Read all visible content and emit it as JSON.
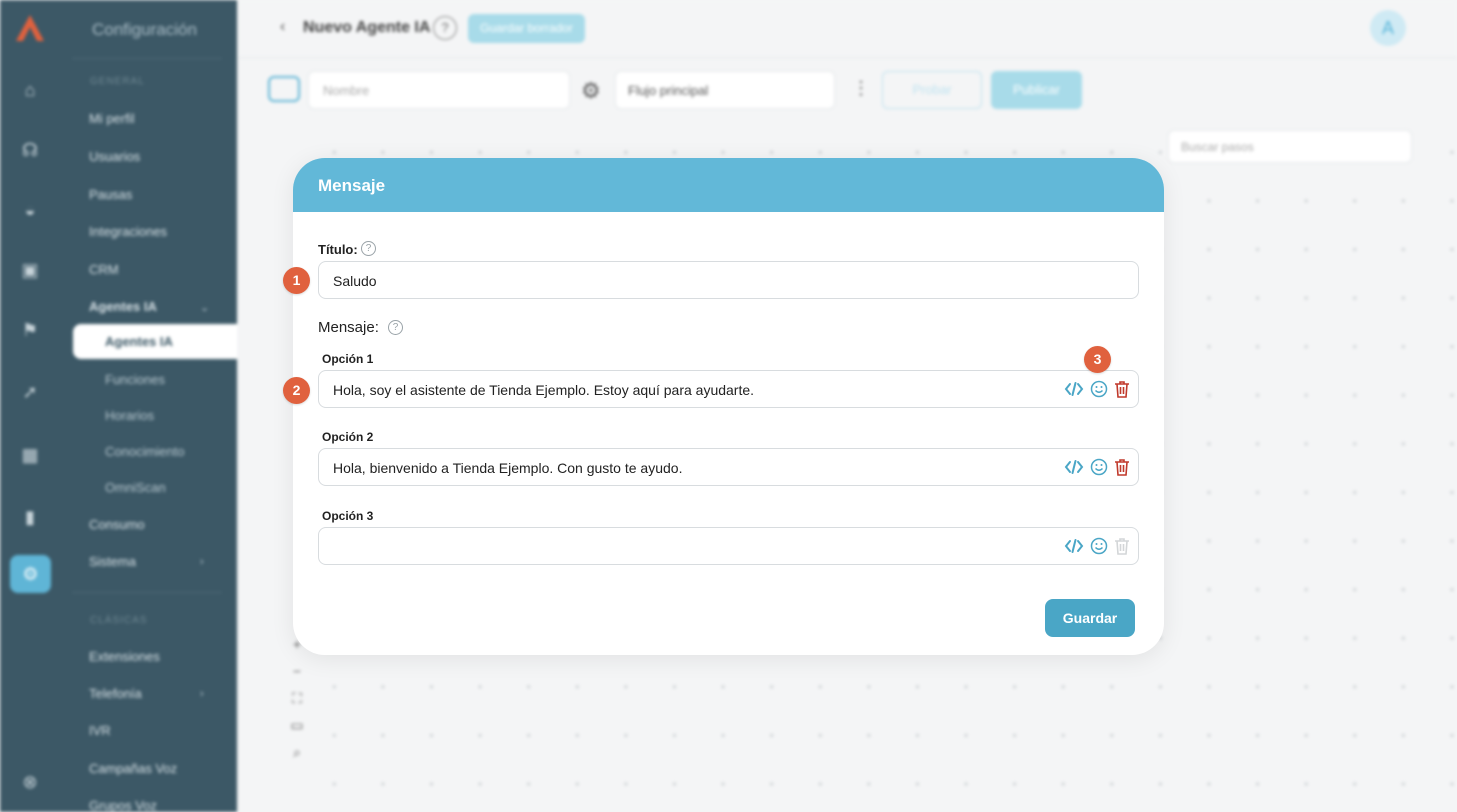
{
  "colors": {
    "accent": "#62b8d8",
    "sidebar": "#3c5866",
    "marker": "#e0613e",
    "danger": "#c0392b"
  },
  "sidebar": {
    "title": "Configuración",
    "section_general": "GENERAL",
    "items": [
      "Mi perfil",
      "Usuarios",
      "Pausas",
      "Integraciones",
      "CRM",
      "Agentes IA"
    ],
    "subitems": [
      "Agentes IA",
      "Funciones",
      "Horarios",
      "Conocimiento",
      "OmniScan"
    ],
    "items_after": [
      "Consumo",
      "Sistema"
    ],
    "section_telephony": "CLÁSICAS",
    "items_bottom": [
      "Extensiones",
      "Telefonía",
      "IVR",
      "Campañas Voz",
      "Grupos Voz"
    ]
  },
  "topbar": {
    "title": "Nuevo Agente IA",
    "badge": "Guardar borrador",
    "avatar": "A"
  },
  "toolbar": {
    "name_placeholder": "Nombre",
    "flow": "Flujo principal",
    "test_label": "Probar",
    "publish_label": "Publicar"
  },
  "canvas": {
    "search_placeholder": "Buscar pasos"
  },
  "modal": {
    "title": "Mensaje",
    "title_label": "Título:",
    "title_value": "Saludo",
    "message_label": "Mensaje:",
    "options": [
      {
        "label": "Opción 1",
        "value": "Hola, soy el asistente de Tienda Ejemplo. Estoy aquí para ayudarte."
      },
      {
        "label": "Opción 2",
        "value": "Hola, bienvenido a Tienda Ejemplo. Con gusto te ayudo."
      },
      {
        "label": "Opción 3",
        "value": ""
      }
    ],
    "save_label": "Guardar"
  },
  "markers": [
    "1",
    "2",
    "3"
  ]
}
